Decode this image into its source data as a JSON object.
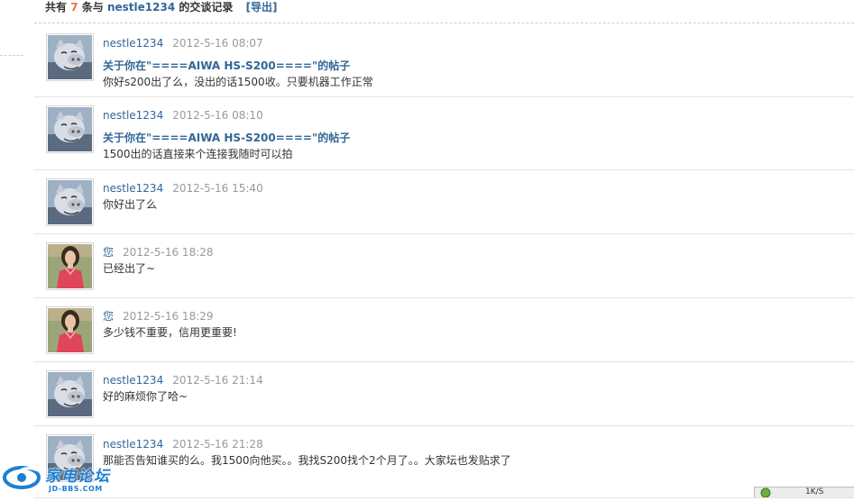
{
  "header": {
    "prefix": "共有",
    "count": "7",
    "middle": "条与",
    "user": "nestle1234",
    "suffix": "的交谈记录",
    "export": "[导出]"
  },
  "messages": [
    {
      "name": "nestle1234",
      "time": "2012-5-16 08:07",
      "avatar": "pig",
      "subject": "关于你在\"====AIWA HS-S200====\"的帖子",
      "text": "你好s200出了么，没出的话1500收。只要机器工作正常"
    },
    {
      "name": "nestle1234",
      "time": "2012-5-16 08:10",
      "avatar": "pig",
      "subject": "关于你在\"====AIWA HS-S200====\"的帖子",
      "text": "1500出的话直接来个连接我随时可以拍"
    },
    {
      "name": "nestle1234",
      "time": "2012-5-16 15:40",
      "avatar": "pig",
      "subject": "",
      "text": "你好出了么"
    },
    {
      "name": "您",
      "time": "2012-5-16 18:28",
      "avatar": "woman",
      "subject": "",
      "text": "已经出了~"
    },
    {
      "name": "您",
      "time": "2012-5-16 18:29",
      "avatar": "woman",
      "subject": "",
      "text": "多少钱不重要，信用更重要!"
    },
    {
      "name": "nestle1234",
      "time": "2012-5-16 21:14",
      "avatar": "pig",
      "subject": "",
      "text": "好的麻烦你了哈~"
    },
    {
      "name": "nestle1234",
      "time": "2012-5-16 21:28",
      "avatar": "pig",
      "subject": "",
      "text": "那能否告知谁买的么。我1500向他买。。我找S200找个2个月了。。大家坛也发贴求了"
    }
  ],
  "watermark": {
    "brand": "家电论坛",
    "url": "JD-BBS.COM"
  },
  "status": {
    "text": "1K/S",
    "icon": "network-icon"
  }
}
